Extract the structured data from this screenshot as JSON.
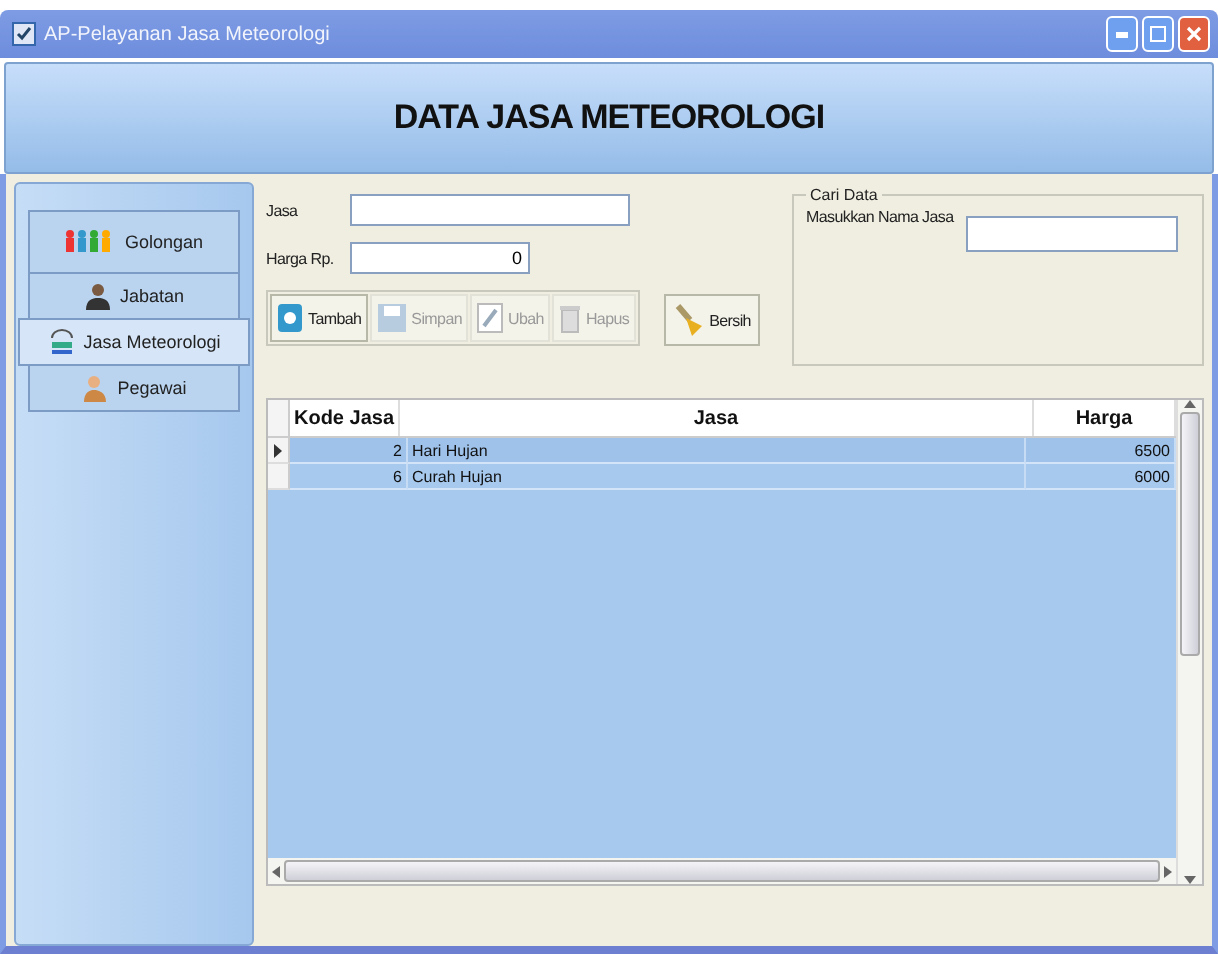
{
  "window": {
    "title": "AP-Pelayanan Jasa Meteorologi"
  },
  "header": {
    "title": "DATA JASA METEOROLOGI"
  },
  "sidebar": {
    "items": [
      {
        "label": "Golongan",
        "kind": "people",
        "selected": false
      },
      {
        "label": "Jabatan",
        "kind": "person",
        "selected": false
      },
      {
        "label": "Jasa Meteorologi",
        "kind": "meteo",
        "selected": true
      },
      {
        "label": "Pegawai",
        "kind": "worker",
        "selected": false
      }
    ]
  },
  "form": {
    "fields": [
      {
        "label": "Jasa",
        "kind": "text"
      },
      {
        "label": "Harga Rp.",
        "value": "0",
        "kind": "number"
      }
    ]
  },
  "toolbar": {
    "buttons": [
      {
        "label": "Tambah",
        "kind": "add",
        "disabled": false
      },
      {
        "label": "Simpan",
        "kind": "save",
        "disabled": true
      },
      {
        "label": "Ubah",
        "kind": "edit",
        "disabled": true
      },
      {
        "label": "Hapus",
        "kind": "delete",
        "disabled": true
      }
    ],
    "clear_button": {
      "label": "Bersih"
    }
  },
  "search": {
    "title": "Cari Data",
    "label": "Masukkan Nama Jasa"
  },
  "table": {
    "columns": [
      "Kode Jasa",
      "Jasa",
      "Harga"
    ],
    "rows": [
      {
        "cells": [
          "2",
          "Hari Hujan",
          "6500"
        ],
        "selected": true
      },
      {
        "cells": [
          "6",
          "Curah Hujan",
          "6000"
        ],
        "selected": false
      }
    ]
  }
}
